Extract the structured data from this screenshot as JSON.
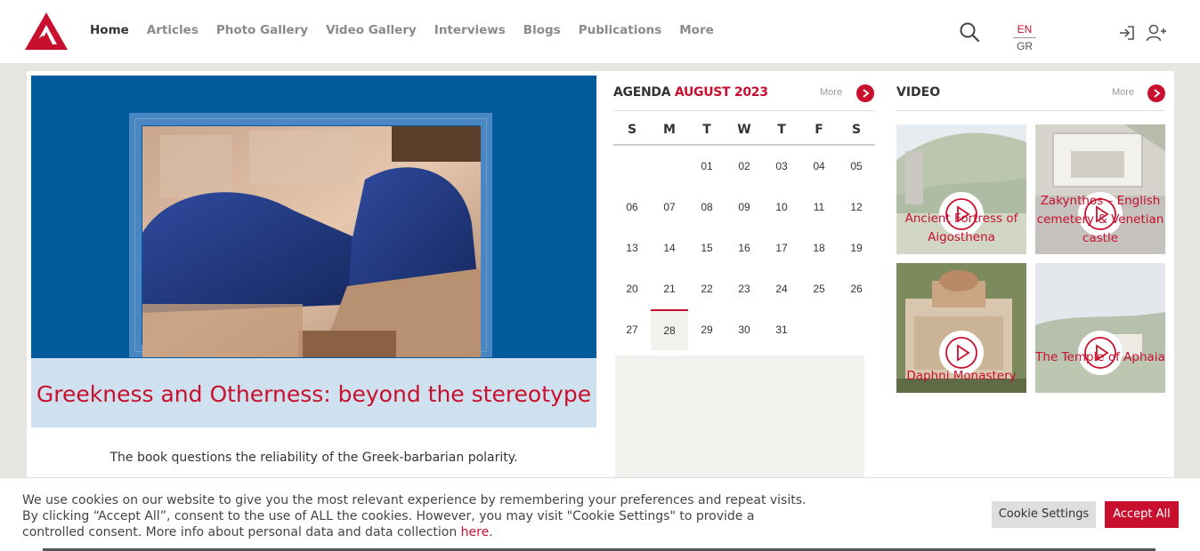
{
  "colors": {
    "brand": "#c8102e",
    "hero_blue": "#005a9c",
    "caption_bg": "#cfe0ee",
    "panel_bg": "#f3f1ee"
  },
  "nav": {
    "items": [
      {
        "label": "Home",
        "active": true
      },
      {
        "label": "Articles"
      },
      {
        "label": "Photo Gallery"
      },
      {
        "label": "Video Gallery"
      },
      {
        "label": "Interviews"
      },
      {
        "label": "Blogs"
      },
      {
        "label": "Publications"
      },
      {
        "label": "More"
      }
    ]
  },
  "lang": {
    "current": "EN",
    "other": "GR"
  },
  "hero": {
    "title": "Greekness and Otherness: beyond the stereotype",
    "description": "The book questions the reliability of the Greek-barbarian polarity."
  },
  "agenda": {
    "label": "AGENDA",
    "month": "AUGUST 2023",
    "more": "More",
    "weekdays": [
      "S",
      "M",
      "T",
      "W",
      "T",
      "F",
      "S"
    ],
    "weeks": [
      [
        "",
        "",
        "01",
        "02",
        "03",
        "04",
        "05"
      ],
      [
        "06",
        "07",
        "08",
        "09",
        "10",
        "11",
        "12"
      ],
      [
        "13",
        "14",
        "15",
        "16",
        "17",
        "18",
        "19"
      ],
      [
        "20",
        "21",
        "22",
        "23",
        "24",
        "25",
        "26"
      ],
      [
        "27",
        "28",
        "29",
        "30",
        "31",
        "",
        ""
      ]
    ],
    "today": "28"
  },
  "video": {
    "label": "VIDEO",
    "more": "More",
    "items": [
      {
        "title": "Ancient Fortress of Aigosthena"
      },
      {
        "title": "Zakynthos – English cemetery & Venetian castle"
      },
      {
        "title": "Daphni Monastery"
      },
      {
        "title": "The Temple of Aphaia"
      }
    ]
  },
  "cookie": {
    "text": "We use cookies on our website to give you the most relevant experience by remembering your preferences and repeat visits. By clicking “Accept All”, consent to the use of ALL the cookies. However, you may visit \"Cookie Settings\" to provide a controlled consent. More info about personal data and data collection ",
    "link": "here",
    "tail": ".",
    "settings_label": "Cookie Settings",
    "accept_label": "Accept All"
  }
}
